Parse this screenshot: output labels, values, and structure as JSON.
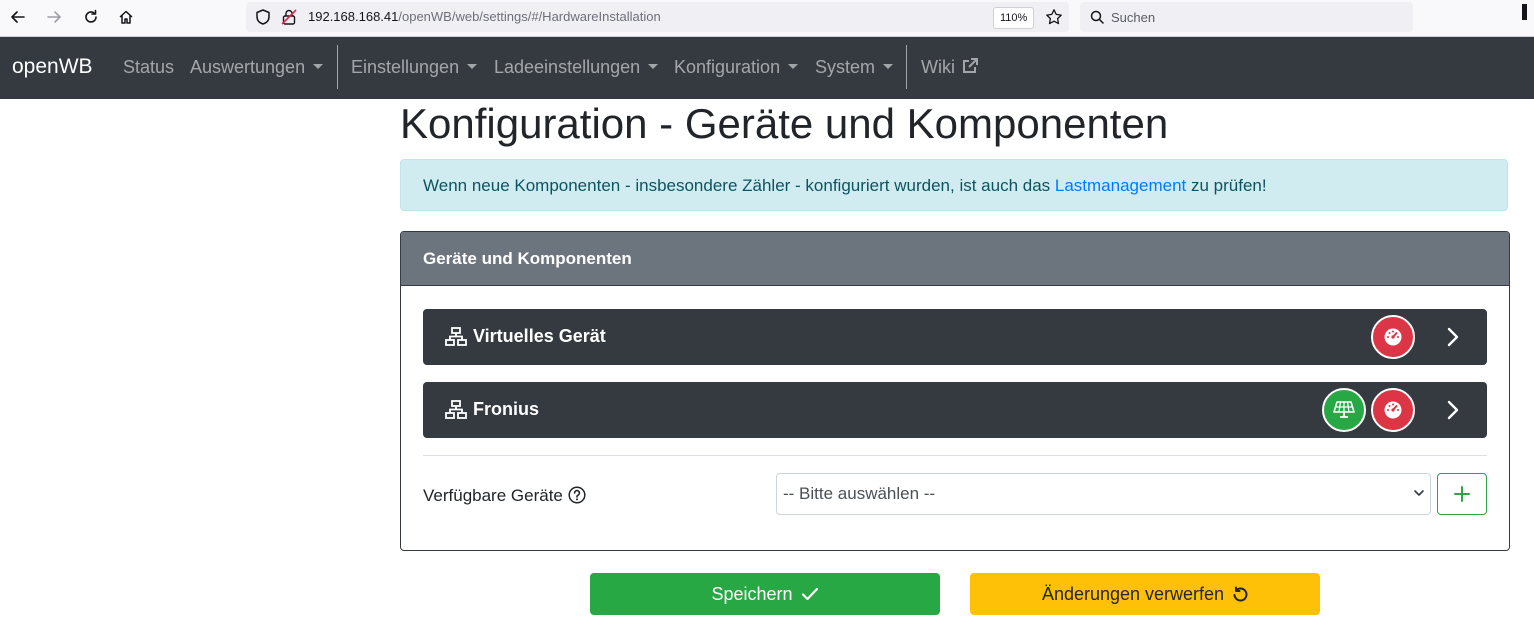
{
  "browser": {
    "url_host": "192.168.168.41",
    "url_path": "/openWB/web/settings/#/HardwareInstallation",
    "zoom": "110%",
    "search_placeholder": "Suchen"
  },
  "navbar": {
    "brand": "openWB",
    "items": [
      {
        "label": "Status",
        "dropdown": false
      },
      {
        "label": "Auswertungen",
        "dropdown": true
      },
      {
        "label": "Einstellungen",
        "dropdown": true
      },
      {
        "label": "Ladeeinstellungen",
        "dropdown": true
      },
      {
        "label": "Konfiguration",
        "dropdown": true
      },
      {
        "label": "System",
        "dropdown": true
      },
      {
        "label": "Wiki",
        "dropdown": false,
        "external": true
      }
    ]
  },
  "page": {
    "title": "Konfiguration - Geräte und Komponenten"
  },
  "alert": {
    "text_before": "Wenn neue Komponenten - insbesondere Zähler - konfiguriert wurden, ist auch das ",
    "link": "Lastmanagement",
    "text_after": " zu prüfen!"
  },
  "card": {
    "header": "Geräte und Komponenten",
    "devices": [
      {
        "name": "Virtuelles Gerät",
        "components": [
          "counter"
        ]
      },
      {
        "name": "Fronius",
        "components": [
          "pv",
          "counter"
        ]
      }
    ],
    "available_label": "Verfügbare Geräte",
    "select_value": "-- Bitte auswählen --"
  },
  "actions": {
    "save_label": "Speichern",
    "discard_label": "Änderungen verwerfen"
  },
  "colors": {
    "navbar_bg": "#343a40",
    "card_header_bg": "#6c757d",
    "counter_badge": "#dc3545",
    "pv_badge": "#28a745",
    "save": "#28a745",
    "discard": "#ffc107",
    "alert_bg": "#d1ecf1"
  }
}
